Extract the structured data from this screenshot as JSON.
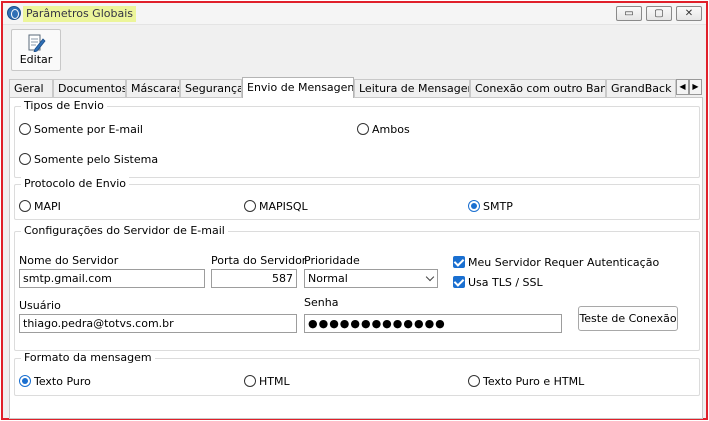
{
  "window": {
    "title": "Parâmetros Globais",
    "controls": {
      "minimize": "▭",
      "restore": "▢",
      "close": "✕"
    }
  },
  "toolbar": {
    "edit_label": "Editar",
    "edit_icon": "pencil-document-icon"
  },
  "tabs": [
    {
      "label": "Geral",
      "active": false
    },
    {
      "label": "Documentos",
      "active": false
    },
    {
      "label": "Máscaras",
      "active": false
    },
    {
      "label": "Segurança",
      "active": false
    },
    {
      "label": "Envio de Mensagens",
      "active": true
    },
    {
      "label": "Leitura de Mensagens",
      "active": false
    },
    {
      "label": "Conexão com outro Banco",
      "active": false
    },
    {
      "label": "GrandBack / I",
      "active": false
    }
  ],
  "tab_scroll": {
    "left": "◀",
    "right": "▶"
  },
  "tipos_envio": {
    "title": "Tipos de Envio",
    "options": {
      "email": "Somente por E-mail",
      "ambos": "Ambos",
      "sistema": "Somente pelo Sistema"
    },
    "selected": "none"
  },
  "protocolo": {
    "title": "Protocolo de Envio",
    "options": {
      "mapi": "MAPI",
      "mapisql": "MAPISQL",
      "smtp": "SMTP"
    },
    "selected": "SMTP"
  },
  "servidor": {
    "title": "Configurações do Servidor de E-mail",
    "nome_label": "Nome do Servidor",
    "nome_value": "smtp.gmail.com",
    "porta_label": "Porta do Servidor",
    "porta_value": "587",
    "prioridade_label": "Prioridade",
    "prioridade_value": "Normal",
    "auth_label": "Meu Servidor Requer Autenticação",
    "auth_checked": true,
    "tls_label": "Usa TLS / SSL",
    "tls_checked": true,
    "usuario_label": "Usuário",
    "usuario_value": "thiago.pedra@totvs.com.br",
    "senha_label": "Senha",
    "senha_value": "●●●●●●●●●●●●●",
    "test_button": "Teste de Conexão"
  },
  "formato": {
    "title": "Formato da mensagem",
    "options": {
      "texto": "Texto Puro",
      "html": "HTML",
      "ambos": "Texto Puro e HTML"
    },
    "selected": "Texto Puro"
  },
  "colors": {
    "accent": "#1a6fd0",
    "frame": "#e0202a",
    "title_highlight": "#ecf59a"
  }
}
